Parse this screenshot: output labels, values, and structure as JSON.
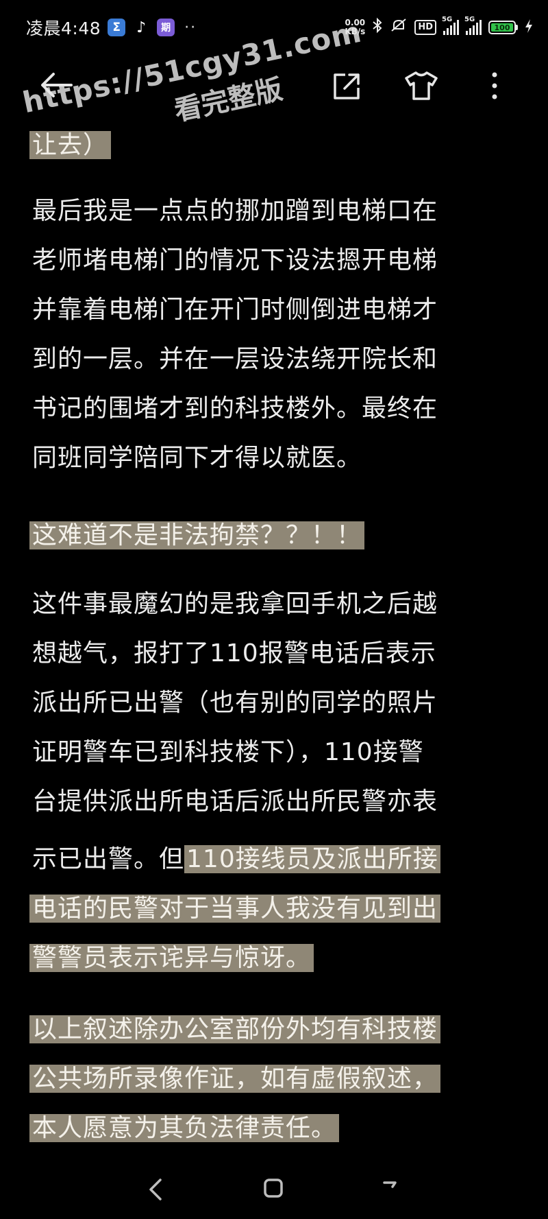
{
  "status_bar": {
    "time": "凌晨4:48",
    "app_icons": [
      "Σ",
      "♪",
      "期"
    ],
    "more": "··",
    "net_speed_value": "0.00",
    "net_speed_unit": "KB/s",
    "hd_label": "HD",
    "signal1_label": "5G",
    "signal2_label": "5G",
    "battery_level": "100"
  },
  "toolbar": {
    "back_icon": "arrow-left-icon",
    "share_icon": "share-icon",
    "theme_icon": "tshirt-icon",
    "more_icon": "more-vertical-icon"
  },
  "watermark": {
    "url": "https://51cgy31.com",
    "subtitle": "看完整版"
  },
  "article": {
    "lines": [
      {
        "text": "让去）",
        "highlight": true
      },
      {
        "text": "最后我是一点点的挪加蹭到电梯口在",
        "highlight": false
      },
      {
        "text": "老师堵电梯门的情况下设法摁开电梯",
        "highlight": false
      },
      {
        "text": "并靠着电梯门在开门时侧倒进电梯才",
        "highlight": false
      },
      {
        "text": "到的一层。并在一层设法绕开院长和",
        "highlight": false
      },
      {
        "text": "书记的围堵才到的科技楼外。最终在",
        "highlight": false
      },
      {
        "text": "同班同学陪同下才得以就医。",
        "highlight": false
      },
      {
        "text": "这难道不是非法拘禁？？！！",
        "highlight": true
      },
      {
        "text": "这件事最魔幻的是我拿回手机之后越",
        "highlight": false
      },
      {
        "text": "想越气，报打了110报警电话后表示",
        "highlight": false
      },
      {
        "text": "派出所已出警（也有别的同学的照片",
        "highlight": false
      },
      {
        "text": "证明警车已到科技楼下），110接警",
        "highlight": false
      },
      {
        "text": "台提供派出所电话后派出所民警亦表",
        "highlight": false
      },
      {
        "text": "电话的民警对于当事人我没有见到出",
        "highlight": true
      },
      {
        "text": "警警员表示诧异与惊讶。",
        "highlight": true
      },
      {
        "text": "以上叙述除办公室部份外均有科技楼",
        "highlight": true
      },
      {
        "text": "公共场所录像作证，如有虚假叙述，",
        "highlight": true
      },
      {
        "text": "本人愿意为其负法律责任。",
        "highlight": true
      }
    ],
    "mixed_line": {
      "plain": "示已出警。但",
      "highlighted": "110接线员及派出所接"
    }
  },
  "nav_bar": {
    "back_icon": "nav-back-icon",
    "home_icon": "nav-home-icon",
    "recent_icon": "nav-recent-icon"
  },
  "colors": {
    "background": "#000000",
    "text": "#ececec",
    "highlight": "#8f8776",
    "battery": "#31c24a"
  }
}
